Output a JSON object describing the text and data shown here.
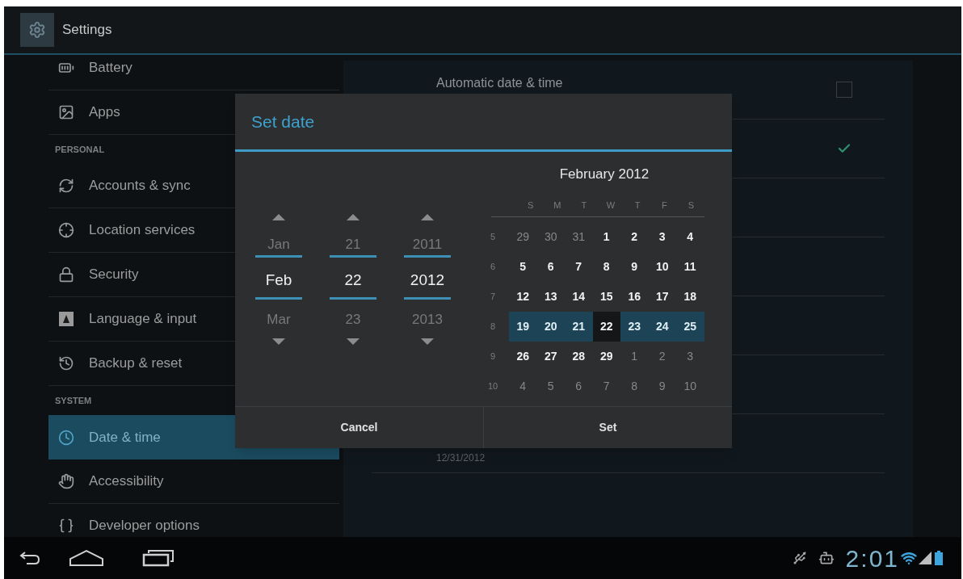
{
  "action_bar": {
    "title": "Settings"
  },
  "sidebar": {
    "items": [
      {
        "kind": "item",
        "label": "Battery",
        "selected": false
      },
      {
        "kind": "item",
        "label": "Apps",
        "selected": false
      },
      {
        "kind": "header",
        "label": "PERSONAL"
      },
      {
        "kind": "item",
        "label": "Accounts & sync",
        "selected": false
      },
      {
        "kind": "item",
        "label": "Location services",
        "selected": false
      },
      {
        "kind": "item",
        "label": "Security",
        "selected": false
      },
      {
        "kind": "item",
        "label": "Language & input",
        "selected": false
      },
      {
        "kind": "item",
        "label": "Backup & reset",
        "selected": false
      },
      {
        "kind": "header",
        "label": "SYSTEM"
      },
      {
        "kind": "item",
        "label": "Date & time",
        "selected": true
      },
      {
        "kind": "item",
        "label": "Accessibility",
        "selected": false
      },
      {
        "kind": "item",
        "label": "Developer options",
        "selected": false
      }
    ]
  },
  "detail": {
    "rows": [
      {
        "kind": "checkbox",
        "label": "Automatic date & time",
        "checked": false
      },
      {
        "kind": "checkbox",
        "checked": true
      },
      {
        "kind": "blank"
      },
      {
        "kind": "blank"
      },
      {
        "kind": "blank"
      },
      {
        "kind": "blank"
      },
      {
        "kind": "summary",
        "summary": "12/31/2012"
      }
    ]
  },
  "dialog": {
    "title": "Set date",
    "pickers": [
      {
        "prev": "Jan",
        "value": "Feb",
        "next": "Mar"
      },
      {
        "prev": "21",
        "value": "22",
        "next": "23"
      },
      {
        "prev": "2011",
        "value": "2012",
        "next": "2013"
      }
    ],
    "calendar": {
      "title": "February 2012",
      "weekdays": [
        "S",
        "M",
        "T",
        "W",
        "T",
        "F",
        "S"
      ],
      "weeks": [
        {
          "number": "5",
          "days": [
            {
              "label": "29",
              "in_month": false,
              "highlighted": false,
              "selected": false
            },
            {
              "label": "30",
              "in_month": false,
              "highlighted": false,
              "selected": false
            },
            {
              "label": "31",
              "in_month": false,
              "highlighted": false,
              "selected": false
            },
            {
              "label": "1",
              "in_month": true,
              "highlighted": false,
              "selected": false
            },
            {
              "label": "2",
              "in_month": true,
              "highlighted": false,
              "selected": false
            },
            {
              "label": "3",
              "in_month": true,
              "highlighted": false,
              "selected": false
            },
            {
              "label": "4",
              "in_month": true,
              "highlighted": false,
              "selected": false
            }
          ]
        },
        {
          "number": "6",
          "days": [
            {
              "label": "5",
              "in_month": true,
              "highlighted": false,
              "selected": false
            },
            {
              "label": "6",
              "in_month": true,
              "highlighted": false,
              "selected": false
            },
            {
              "label": "7",
              "in_month": true,
              "highlighted": false,
              "selected": false
            },
            {
              "label": "8",
              "in_month": true,
              "highlighted": false,
              "selected": false
            },
            {
              "label": "9",
              "in_month": true,
              "highlighted": false,
              "selected": false
            },
            {
              "label": "10",
              "in_month": true,
              "highlighted": false,
              "selected": false
            },
            {
              "label": "11",
              "in_month": true,
              "highlighted": false,
              "selected": false
            }
          ]
        },
        {
          "number": "7",
          "days": [
            {
              "label": "12",
              "in_month": true,
              "highlighted": false,
              "selected": false
            },
            {
              "label": "13",
              "in_month": true,
              "highlighted": false,
              "selected": false
            },
            {
              "label": "14",
              "in_month": true,
              "highlighted": false,
              "selected": false
            },
            {
              "label": "15",
              "in_month": true,
              "highlighted": false,
              "selected": false
            },
            {
              "label": "16",
              "in_month": true,
              "highlighted": false,
              "selected": false
            },
            {
              "label": "17",
              "in_month": true,
              "highlighted": false,
              "selected": false
            },
            {
              "label": "18",
              "in_month": true,
              "highlighted": false,
              "selected": false
            }
          ]
        },
        {
          "number": "8",
          "days": [
            {
              "label": "19",
              "in_month": true,
              "highlighted": true,
              "selected": false
            },
            {
              "label": "20",
              "in_month": true,
              "highlighted": true,
              "selected": false
            },
            {
              "label": "21",
              "in_month": true,
              "highlighted": true,
              "selected": false
            },
            {
              "label": "22",
              "in_month": true,
              "highlighted": false,
              "selected": true
            },
            {
              "label": "23",
              "in_month": true,
              "highlighted": true,
              "selected": false
            },
            {
              "label": "24",
              "in_month": true,
              "highlighted": true,
              "selected": false
            },
            {
              "label": "25",
              "in_month": true,
              "highlighted": true,
              "selected": false
            }
          ]
        },
        {
          "number": "9",
          "days": [
            {
              "label": "26",
              "in_month": true,
              "highlighted": false,
              "selected": false
            },
            {
              "label": "27",
              "in_month": true,
              "highlighted": false,
              "selected": false
            },
            {
              "label": "28",
              "in_month": true,
              "highlighted": false,
              "selected": false
            },
            {
              "label": "29",
              "in_month": true,
              "highlighted": false,
              "selected": false
            },
            {
              "label": "1",
              "in_month": false,
              "highlighted": false,
              "selected": false
            },
            {
              "label": "2",
              "in_month": false,
              "highlighted": false,
              "selected": false
            },
            {
              "label": "3",
              "in_month": false,
              "highlighted": false,
              "selected": false
            }
          ]
        },
        {
          "number": "10",
          "days": [
            {
              "label": "4",
              "in_month": false,
              "highlighted": false,
              "selected": false
            },
            {
              "label": "5",
              "in_month": false,
              "highlighted": false,
              "selected": false
            },
            {
              "label": "6",
              "in_month": false,
              "highlighted": false,
              "selected": false
            },
            {
              "label": "7",
              "in_month": false,
              "highlighted": false,
              "selected": false
            },
            {
              "label": "8",
              "in_month": false,
              "highlighted": false,
              "selected": false
            },
            {
              "label": "9",
              "in_month": false,
              "highlighted": false,
              "selected": false
            },
            {
              "label": "10",
              "in_month": false,
              "highlighted": false,
              "selected": false
            }
          ]
        }
      ]
    },
    "buttons": [
      "Cancel",
      "Set"
    ]
  },
  "status_bar": {
    "clock": "2:01"
  }
}
